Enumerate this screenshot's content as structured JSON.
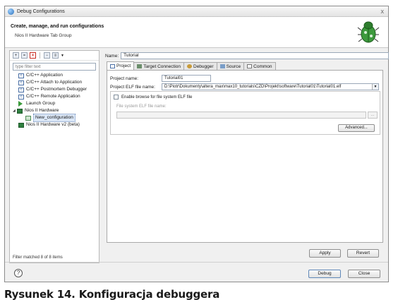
{
  "window": {
    "title": "Debug Configurations",
    "close_glyph": "x"
  },
  "header": {
    "title": "Create, manage, and run configurations",
    "subtitle": "Nios II Hardware Tab Group",
    "icon": "debug-bug-icon"
  },
  "left_panel": {
    "filter_placeholder": "type filter text",
    "tree": [
      {
        "label": "C/C++ Application",
        "icon": "cpp-icon",
        "level": 1
      },
      {
        "label": "C/C++ Attach to Application",
        "icon": "cpp-icon",
        "level": 1
      },
      {
        "label": "C/C++ Postmortem Debugger",
        "icon": "cpp-icon",
        "level": 1
      },
      {
        "label": "C/C++ Remote Application",
        "icon": "cpp-icon",
        "level": 1
      },
      {
        "label": "Launch Group",
        "icon": "launch-icon",
        "level": 1
      },
      {
        "label": "Nios II Hardware",
        "icon": "nios-icon",
        "level": 0,
        "expanded": true
      },
      {
        "label": "New_configuration",
        "icon": "config-icon",
        "level": 2,
        "selected": true
      },
      {
        "label": "Nios II Hardware v2 (beta)",
        "icon": "nios-icon",
        "level": 1
      }
    ],
    "status": "Filter matched 8 of 8 items"
  },
  "right_panel": {
    "name_label": "Name:",
    "name_value": "Tutorial",
    "tabs": [
      {
        "label": "Project",
        "active": true
      },
      {
        "label": "Target Connection"
      },
      {
        "label": "Debugger"
      },
      {
        "label": "Source"
      },
      {
        "label": "Common"
      }
    ],
    "project_name_label": "Project name:",
    "project_name_value": "Tutorial01",
    "elf_label": "Project ELF file name:",
    "elf_value": "D:\\Piotr\\Dokumenty\\altera_max\\max10_tutorials\\CZD\\Projekt\\software\\Tutorial01\\Tutorial01.elf",
    "bypass_checkbox_label": "Enable browse for file system ELF file",
    "fs_elf_label": "File system ELF file name:",
    "browse_label": "...",
    "advanced_label": "Advanced...",
    "apply_label": "Apply",
    "revert_label": "Revert"
  },
  "footer": {
    "help_glyph": "?",
    "debug_label": "Debug",
    "close_label": "Close"
  },
  "caption": "Rysunek 14. Konfiguracja debuggera"
}
